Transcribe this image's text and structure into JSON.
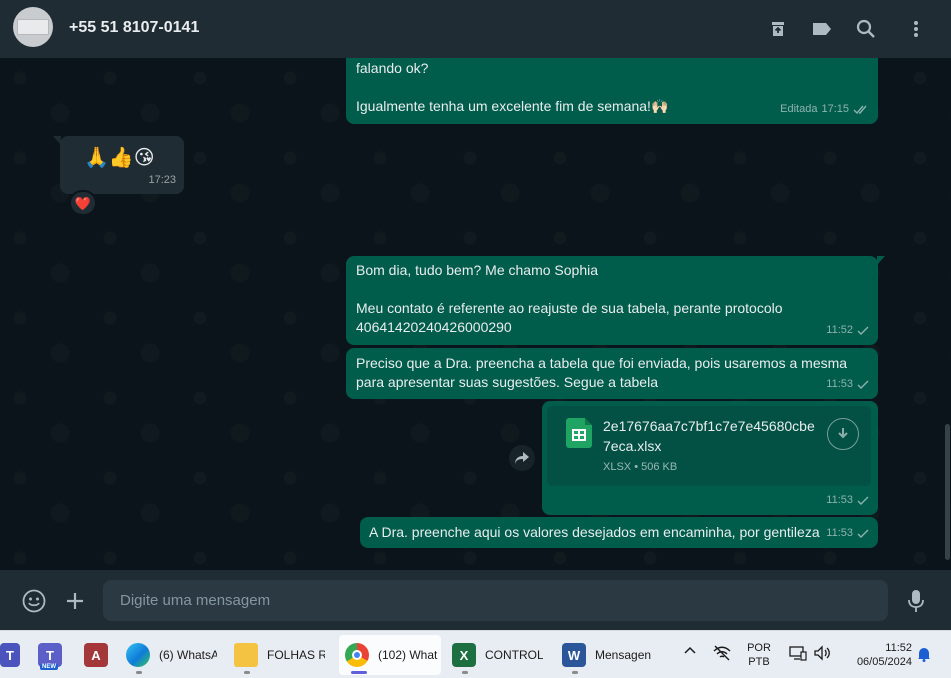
{
  "header": {
    "contact": "+55 51 8107-0141",
    "icons": [
      "archive-icon",
      "label-icon",
      "search-icon",
      "menu-dots-icon"
    ]
  },
  "messages": {
    "m1": {
      "text": "falando ok?\n\nIgualmente tenha um excelente fim de semana!🙌🏻",
      "edited": "Editada",
      "time": "17:15",
      "status": "read"
    },
    "m2": {
      "text": "🙏👍😘",
      "time": "17:23"
    },
    "m2_reaction": "❤️",
    "m3": {
      "text": "Bom dia, tudo bem? Me chamo Sophia\n\nMeu contato é referente ao reajuste de sua tabela, perante protocolo 40641420240426000290",
      "time": "11:52",
      "status": "sent"
    },
    "m4": {
      "text": "Preciso que a Dra. preencha a tabela que foi enviada, pois usaremos a mesma para apresentar suas sugestões. Segue a tabela",
      "time": "11:53",
      "status": "sent"
    },
    "m5": {
      "file_name": "2e17676aa7c7bf1c7e7e45680cbe7eca.xlsx",
      "file_type": "XLSX",
      "file_size": "506 KB",
      "time": "11:53",
      "status": "sent"
    },
    "m6": {
      "text": "A Dra. preenche aqui os valores desejados em encaminha, por gentileza",
      "time": "11:53",
      "status": "sent"
    }
  },
  "composer": {
    "placeholder": "Digite uma mensagem",
    "icons": [
      "emoji-icon",
      "attach-plus-icon",
      "microphone-icon"
    ]
  },
  "taskbar": {
    "apps": [
      {
        "label": "",
        "icon": "teams-icon"
      },
      {
        "label": "",
        "icon": "teams-new-icon",
        "badge": "NEW"
      },
      {
        "label": "",
        "icon": "access-icon"
      },
      {
        "label": "(6) WhatsA",
        "icon": "edge-icon"
      },
      {
        "label": "FOLHAS RC",
        "icon": "folder-icon"
      },
      {
        "label": "(102) What",
        "icon": "chrome-icon"
      },
      {
        "label": "CONTROLI",
        "icon": "excel-icon"
      },
      {
        "label": "Mensagen",
        "icon": "word-icon"
      }
    ],
    "language_1": "POR",
    "language_2": "PTB",
    "time": "11:52",
    "date": "06/05/2024"
  },
  "colors": {
    "outgoing_bubble": "#005c4b",
    "incoming_bubble": "#202c33",
    "chat_bg": "#0b141a",
    "header_bg": "#202c33",
    "read_tick": "#53bdeb"
  }
}
